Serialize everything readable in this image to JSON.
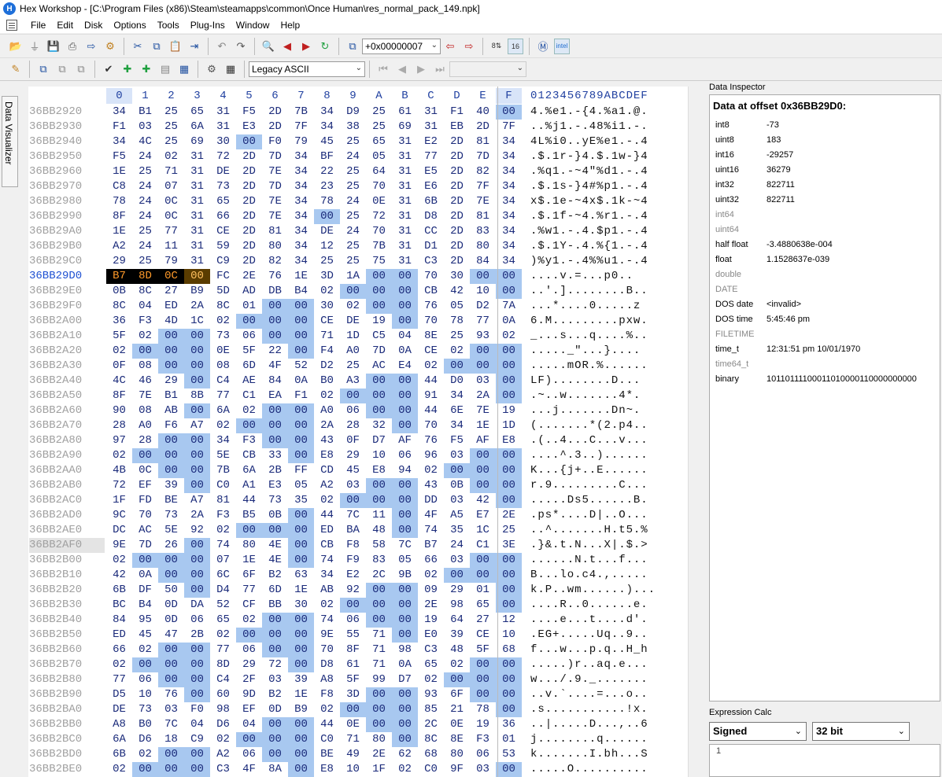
{
  "window": {
    "title": "Hex Workshop - [C:\\Program Files (x86)\\Steam\\steamapps\\common\\Once Human\\res_normal_pack_149.npk]"
  },
  "menu": [
    "File",
    "Edit",
    "Disk",
    "Options",
    "Tools",
    "Plug-Ins",
    "Window",
    "Help"
  ],
  "toolbar": {
    "goto_value": "+0x00000007",
    "encoding_value": "Legacy ASCII"
  },
  "side_tab": "Data Visualizer",
  "hex": {
    "columns": [
      "0",
      "1",
      "2",
      "3",
      "4",
      "5",
      "6",
      "7",
      "8",
      "9",
      "A",
      "B",
      "C",
      "D",
      "E",
      "F"
    ],
    "text_header": "0123456789ABCDEF",
    "rows": [
      {
        "off": "36BB2920",
        "bytes": [
          "34",
          "B1",
          "25",
          "65",
          "31",
          "F5",
          "2D",
          "7B",
          "34",
          "D9",
          "25",
          "61",
          "31",
          "F1",
          "40",
          "00"
        ],
        "text": "4.%e1.-{4.%a1.@."
      },
      {
        "off": "36BB2930",
        "bytes": [
          "F1",
          "03",
          "25",
          "6A",
          "31",
          "E3",
          "2D",
          "7F",
          "34",
          "38",
          "25",
          "69",
          "31",
          "EB",
          "2D",
          "7F"
        ],
        "text": "..%j1.-.48%i1.-."
      },
      {
        "off": "36BB2940",
        "bytes": [
          "34",
          "4C",
          "25",
          "69",
          "30",
          "00",
          "F0",
          "79",
          "45",
          "25",
          "65",
          "31",
          "E2",
          "2D",
          "81",
          "34"
        ],
        "text": "4L%i0..yE%e1.-.4"
      },
      {
        "off": "36BB2950",
        "bytes": [
          "F5",
          "24",
          "02",
          "31",
          "72",
          "2D",
          "7D",
          "34",
          "BF",
          "24",
          "05",
          "31",
          "77",
          "2D",
          "7D",
          "34"
        ],
        "text": ".$.1r-}4.$.1w-}4"
      },
      {
        "off": "36BB2960",
        "bytes": [
          "1E",
          "25",
          "71",
          "31",
          "DE",
          "2D",
          "7E",
          "34",
          "22",
          "25",
          "64",
          "31",
          "E5",
          "2D",
          "82",
          "34"
        ],
        "text": ".%q1.-~4\"%d1.-.4"
      },
      {
        "off": "36BB2970",
        "bytes": [
          "C8",
          "24",
          "07",
          "31",
          "73",
          "2D",
          "7D",
          "34",
          "23",
          "25",
          "70",
          "31",
          "E6",
          "2D",
          "7F",
          "34"
        ],
        "text": ".$.1s-}4#%p1.-.4"
      },
      {
        "off": "36BB2980",
        "bytes": [
          "78",
          "24",
          "0C",
          "31",
          "65",
          "2D",
          "7E",
          "34",
          "78",
          "24",
          "0E",
          "31",
          "6B",
          "2D",
          "7E",
          "34"
        ],
        "text": "x$.1e-~4x$.1k-~4"
      },
      {
        "off": "36BB2990",
        "bytes": [
          "8F",
          "24",
          "0C",
          "31",
          "66",
          "2D",
          "7E",
          "34",
          "00",
          "25",
          "72",
          "31",
          "D8",
          "2D",
          "81",
          "34"
        ],
        "text": ".$.1f-~4.%r1.-.4"
      },
      {
        "off": "36BB29A0",
        "bytes": [
          "1E",
          "25",
          "77",
          "31",
          "CE",
          "2D",
          "81",
          "34",
          "DE",
          "24",
          "70",
          "31",
          "CC",
          "2D",
          "83",
          "34"
        ],
        "text": ".%w1.-.4.$p1.-.4"
      },
      {
        "off": "36BB29B0",
        "bytes": [
          "A2",
          "24",
          "11",
          "31",
          "59",
          "2D",
          "80",
          "34",
          "12",
          "25",
          "7B",
          "31",
          "D1",
          "2D",
          "80",
          "34"
        ],
        "text": ".$.1Y-.4.%{1.-.4"
      },
      {
        "off": "36BB29C0",
        "bytes": [
          "29",
          "25",
          "79",
          "31",
          "C9",
          "2D",
          "82",
          "34",
          "25",
          "25",
          "75",
          "31",
          "C3",
          "2D",
          "84",
          "34"
        ],
        "text": ")%y1.-.4%%u1.-.4"
      },
      {
        "off": "36BB29D0",
        "bytes": [
          "B7",
          "8D",
          "0C",
          "00",
          "FC",
          "2E",
          "76",
          "1E",
          "3D",
          "1A",
          "00",
          "00",
          "70",
          "30",
          "00",
          "00"
        ],
        "text": "....v.=...p0..",
        "active": true
      },
      {
        "off": "36BB29E0",
        "bytes": [
          "0B",
          "8C",
          "27",
          "B9",
          "5D",
          "AD",
          "DB",
          "B4",
          "02",
          "00",
          "00",
          "00",
          "CB",
          "42",
          "10",
          "00"
        ],
        "text": "..'.]........B.."
      },
      {
        "off": "36BB29F0",
        "bytes": [
          "8C",
          "04",
          "ED",
          "2A",
          "8C",
          "01",
          "00",
          "00",
          "30",
          "02",
          "00",
          "00",
          "76",
          "05",
          "D2",
          "7A"
        ],
        "text": "...*....0.....z"
      },
      {
        "off": "36BB2A00",
        "bytes": [
          "36",
          "F3",
          "4D",
          "1C",
          "02",
          "00",
          "00",
          "00",
          "CE",
          "DE",
          "19",
          "00",
          "70",
          "78",
          "77",
          "0A"
        ],
        "text": "6.M.........pxw."
      },
      {
        "off": "36BB2A10",
        "bytes": [
          "5F",
          "02",
          "00",
          "00",
          "73",
          "06",
          "00",
          "00",
          "71",
          "1D",
          "C5",
          "04",
          "8E",
          "25",
          "93",
          "02"
        ],
        "text": "_...s...q....%.."
      },
      {
        "off": "36BB2A20",
        "bytes": [
          "02",
          "00",
          "00",
          "00",
          "0E",
          "5F",
          "22",
          "00",
          "F4",
          "A0",
          "7D",
          "0A",
          "CE",
          "02",
          "00",
          "00"
        ],
        "text": "....._\"...}...."
      },
      {
        "off": "36BB2A30",
        "bytes": [
          "0F",
          "08",
          "00",
          "00",
          "08",
          "6D",
          "4F",
          "52",
          "D2",
          "25",
          "AC",
          "E4",
          "02",
          "00",
          "00",
          "00"
        ],
        "text": ".....mOR.%......"
      },
      {
        "off": "36BB2A40",
        "bytes": [
          "4C",
          "46",
          "29",
          "00",
          "C4",
          "AE",
          "84",
          "0A",
          "B0",
          "A3",
          "00",
          "00",
          "44",
          "D0",
          "03",
          "00"
        ],
        "text": "LF)........D..."
      },
      {
        "off": "36BB2A50",
        "bytes": [
          "8F",
          "7E",
          "B1",
          "8B",
          "77",
          "C1",
          "EA",
          "F1",
          "02",
          "00",
          "00",
          "00",
          "91",
          "34",
          "2A",
          "00"
        ],
        "text": ".~..w.......4*."
      },
      {
        "off": "36BB2A60",
        "bytes": [
          "90",
          "08",
          "AB",
          "00",
          "6A",
          "02",
          "00",
          "00",
          "A0",
          "06",
          "00",
          "00",
          "44",
          "6E",
          "7E",
          "19"
        ],
        "text": "...j.......Dn~."
      },
      {
        "off": "36BB2A70",
        "bytes": [
          "28",
          "A0",
          "F6",
          "A7",
          "02",
          "00",
          "00",
          "00",
          "2A",
          "28",
          "32",
          "00",
          "70",
          "34",
          "1E",
          "1D"
        ],
        "text": "(.......*(2.p4.."
      },
      {
        "off": "36BB2A80",
        "bytes": [
          "97",
          "28",
          "00",
          "00",
          "34",
          "F3",
          "00",
          "00",
          "43",
          "0F",
          "D7",
          "AF",
          "76",
          "F5",
          "AF",
          "E8"
        ],
        "text": ".(..4...C...v..."
      },
      {
        "off": "36BB2A90",
        "bytes": [
          "02",
          "00",
          "00",
          "00",
          "5E",
          "CB",
          "33",
          "00",
          "E8",
          "29",
          "10",
          "06",
          "96",
          "03",
          "00",
          "00"
        ],
        "text": "....^.3..)......"
      },
      {
        "off": "36BB2AA0",
        "bytes": [
          "4B",
          "0C",
          "00",
          "00",
          "7B",
          "6A",
          "2B",
          "FF",
          "CD",
          "45",
          "E8",
          "94",
          "02",
          "00",
          "00",
          "00"
        ],
        "text": "K...{j+..E......"
      },
      {
        "off": "36BB2AB0",
        "bytes": [
          "72",
          "EF",
          "39",
          "00",
          "C0",
          "A1",
          "E3",
          "05",
          "A2",
          "03",
          "00",
          "00",
          "43",
          "0B",
          "00",
          "00"
        ],
        "text": "r.9.........C..."
      },
      {
        "off": "36BB2AC0",
        "bytes": [
          "1F",
          "FD",
          "BE",
          "A7",
          "81",
          "44",
          "73",
          "35",
          "02",
          "00",
          "00",
          "00",
          "DD",
          "03",
          "42",
          "00"
        ],
        "text": ".....Ds5......B."
      },
      {
        "off": "36BB2AD0",
        "bytes": [
          "9C",
          "70",
          "73",
          "2A",
          "F3",
          "B5",
          "0B",
          "00",
          "44",
          "7C",
          "11",
          "00",
          "4F",
          "A5",
          "E7",
          "2E"
        ],
        "text": ".ps*....D|..O..."
      },
      {
        "off": "36BB2AE0",
        "bytes": [
          "DC",
          "AC",
          "5E",
          "92",
          "02",
          "00",
          "00",
          "00",
          "ED",
          "BA",
          "48",
          "00",
          "74",
          "35",
          "1C",
          "25"
        ],
        "text": "..^.......H.t5.%"
      },
      {
        "off": "36BB2AF0",
        "bytes": [
          "9E",
          "7D",
          "26",
          "00",
          "74",
          "80",
          "4E",
          "00",
          "CB",
          "F8",
          "58",
          "7C",
          "B7",
          "24",
          "C1",
          "3E"
        ],
        "text": ".}&.t.N...X|.$.>",
        "shaded": true
      },
      {
        "off": "36BB2B00",
        "bytes": [
          "02",
          "00",
          "00",
          "00",
          "07",
          "1E",
          "4E",
          "00",
          "74",
          "F9",
          "83",
          "05",
          "66",
          "03",
          "00",
          "00"
        ],
        "text": "......N.t...f..."
      },
      {
        "off": "36BB2B10",
        "bytes": [
          "42",
          "0A",
          "00",
          "00",
          "6C",
          "6F",
          "B2",
          "63",
          "34",
          "E2",
          "2C",
          "9B",
          "02",
          "00",
          "00",
          "00"
        ],
        "text": "B...lo.c4.,....."
      },
      {
        "off": "36BB2B20",
        "bytes": [
          "6B",
          "DF",
          "50",
          "00",
          "D4",
          "77",
          "6D",
          "1E",
          "AB",
          "92",
          "00",
          "00",
          "09",
          "29",
          "01",
          "00"
        ],
        "text": "k.P..wm......)..."
      },
      {
        "off": "36BB2B30",
        "bytes": [
          "BC",
          "B4",
          "0D",
          "DA",
          "52",
          "CF",
          "BB",
          "30",
          "02",
          "00",
          "00",
          "00",
          "2E",
          "98",
          "65",
          "00"
        ],
        "text": "....R..0......e."
      },
      {
        "off": "36BB2B40",
        "bytes": [
          "84",
          "95",
          "0D",
          "06",
          "65",
          "02",
          "00",
          "00",
          "74",
          "06",
          "00",
          "00",
          "19",
          "64",
          "27",
          "12"
        ],
        "text": "....e...t....d'."
      },
      {
        "off": "36BB2B50",
        "bytes": [
          "ED",
          "45",
          "47",
          "2B",
          "02",
          "00",
          "00",
          "00",
          "9E",
          "55",
          "71",
          "00",
          "E0",
          "39",
          "CE",
          "10"
        ],
        "text": ".EG+.....Uq..9.."
      },
      {
        "off": "36BB2B60",
        "bytes": [
          "66",
          "02",
          "00",
          "00",
          "77",
          "06",
          "00",
          "00",
          "70",
          "8F",
          "71",
          "98",
          "C3",
          "48",
          "5F",
          "68"
        ],
        "text": "f...w...p.q..H_h"
      },
      {
        "off": "36BB2B70",
        "bytes": [
          "02",
          "00",
          "00",
          "00",
          "8D",
          "29",
          "72",
          "00",
          "D8",
          "61",
          "71",
          "0A",
          "65",
          "02",
          "00",
          "00"
        ],
        "text": ".....)r..aq.e..."
      },
      {
        "off": "36BB2B80",
        "bytes": [
          "77",
          "06",
          "00",
          "00",
          "C4",
          "2F",
          "03",
          "39",
          "A8",
          "5F",
          "99",
          "D7",
          "02",
          "00",
          "00",
          "00"
        ],
        "text": "w.../.9._......."
      },
      {
        "off": "36BB2B90",
        "bytes": [
          "D5",
          "10",
          "76",
          "00",
          "60",
          "9D",
          "B2",
          "1E",
          "F8",
          "3D",
          "00",
          "00",
          "93",
          "6F",
          "00",
          "00"
        ],
        "text": "..v.`....=...o.."
      },
      {
        "off": "36BB2BA0",
        "bytes": [
          "DE",
          "73",
          "03",
          "F0",
          "98",
          "EF",
          "0D",
          "B9",
          "02",
          "00",
          "00",
          "00",
          "85",
          "21",
          "78",
          "00"
        ],
        "text": ".s...........!x."
      },
      {
        "off": "36BB2BB0",
        "bytes": [
          "A8",
          "B0",
          "7C",
          "04",
          "D6",
          "04",
          "00",
          "00",
          "44",
          "0E",
          "00",
          "00",
          "2C",
          "0E",
          "19",
          "36"
        ],
        "text": "..|.....D...,..6"
      },
      {
        "off": "36BB2BC0",
        "bytes": [
          "6A",
          "D6",
          "18",
          "C9",
          "02",
          "00",
          "00",
          "00",
          "C0",
          "71",
          "80",
          "00",
          "8C",
          "8E",
          "F3",
          "01"
        ],
        "text": "j........q......"
      },
      {
        "off": "36BB2BD0",
        "bytes": [
          "6B",
          "02",
          "00",
          "00",
          "A2",
          "06",
          "00",
          "00",
          "BE",
          "49",
          "2E",
          "62",
          "68",
          "80",
          "06",
          "53"
        ],
        "text": "k.......I.bh...S"
      },
      {
        "off": "36BB2BE0",
        "bytes": [
          "02",
          "00",
          "00",
          "00",
          "C3",
          "4F",
          "8A",
          "00",
          "E8",
          "10",
          "1F",
          "02",
          "C0",
          "9F",
          "03",
          "00"
        ],
        "text": ".....O.........."
      }
    ]
  },
  "inspector": {
    "panel_title": "Data Inspector",
    "heading": "Data at offset 0x36BB29D0:",
    "rows": [
      {
        "k": "int8",
        "v": "-73"
      },
      {
        "k": "uint8",
        "v": "183"
      },
      {
        "k": "int16",
        "v": "-29257"
      },
      {
        "k": "uint16",
        "v": "36279"
      },
      {
        "k": "int32",
        "v": "822711"
      },
      {
        "k": "uint32",
        "v": "822711"
      },
      {
        "k": "int64",
        "v": "",
        "dim": true
      },
      {
        "k": "uint64",
        "v": "",
        "dim": true
      },
      {
        "k": "half float",
        "v": "-3.4880638e-004"
      },
      {
        "k": "float",
        "v": "1.1528637e-039"
      },
      {
        "k": "double",
        "v": "",
        "dim": true
      },
      {
        "k": "DATE",
        "v": "",
        "dim": true
      },
      {
        "k": "DOS date",
        "v": "<invalid>"
      },
      {
        "k": "DOS time",
        "v": "5:45:46 pm"
      },
      {
        "k": "FILETIME",
        "v": "",
        "dim": true
      },
      {
        "k": "time_t",
        "v": "12:31:51 pm 10/01/1970"
      },
      {
        "k": "time64_t",
        "v": "",
        "dim": true
      },
      {
        "k": "binary",
        "v": "10110111100011010000110000000000"
      }
    ]
  },
  "expression_calc": {
    "panel_title": "Expression Calc",
    "sign_mode": "Signed",
    "bit_width": "32 bit",
    "line_number": "1"
  }
}
